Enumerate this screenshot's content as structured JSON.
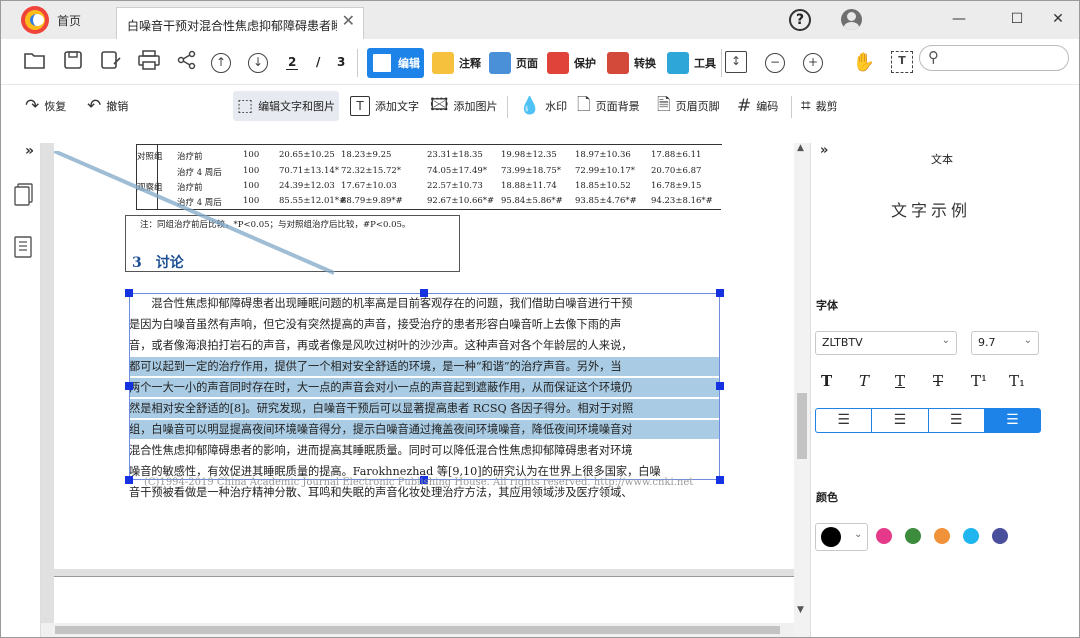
{
  "titlebar": {
    "home_tab": "首页",
    "doc_tab": "白噪音干预对混合性焦虑抑郁障碍患者睡眠质...",
    "close": "✕",
    "help": "?",
    "minimize": "—",
    "maximize": "☐",
    "close_window": "✕"
  },
  "toolbar": {
    "page_current": "2",
    "page_sep": "/",
    "page_total": "3",
    "modes": [
      {
        "label": "编辑",
        "color": "#1d83e8"
      },
      {
        "label": "注释",
        "color": "#f6c23e"
      },
      {
        "label": "页面",
        "color": "#4a90d9"
      },
      {
        "label": "保护",
        "color": "#e0433a"
      },
      {
        "label": "转换",
        "color": "#d44a3a"
      },
      {
        "label": "工具",
        "color": "#2ea7d8"
      }
    ],
    "search_placeholder": ""
  },
  "edit_tools": {
    "redo": "恢复",
    "undo": "撤销",
    "edit_text_image": "编辑文字和图片",
    "add_text": "添加文字",
    "add_image": "添加图片",
    "watermark": "水印",
    "page_background": "页面背景",
    "header_footer": "页眉页脚",
    "encode": "编码",
    "crop": "裁剪"
  },
  "sidebar": {
    "collapse": "»"
  },
  "table": {
    "rows": [
      [
        "对照组",
        "治疗前",
        "100",
        "20.65±10.25",
        "18.23±9.25",
        "23.31±18.35",
        "19.98±12.35",
        "18.97±10.36",
        "17.88±6.11"
      ],
      [
        "",
        "治疗 4 周后",
        "100",
        "70.71±13.14*",
        "72.32±15.72*",
        "74.05±17.49*",
        "73.99±18.75*",
        "72.99±10.17*",
        "20.70±6.87"
      ],
      [
        "观察组",
        "治疗前",
        "100",
        "24.39±12.03",
        "17.67±10.03",
        "22.57±10.73",
        "18.88±11.74",
        "18.85±10.52",
        "16.78±9.15"
      ],
      [
        "",
        "治疗 4 周后",
        "100",
        "85.55±12.01*#",
        "88.79±9.89*#",
        "92.67±10.66*#",
        "95.84±5.86*#",
        "93.85±4.76*#",
        "94.23±8.16*#"
      ]
    ]
  },
  "note_text": "注：同组治疗前后比较，*P<0.05；与对照组治疗后比较，#P<0.05。",
  "heading": "3　讨论",
  "paragraph_lines": [
    "　　混合性焦虑抑郁障碍患者出现睡眠问题的机率高是目前客观存在的问题，我们借助白噪音进行干预",
    "是因为白噪音虽然有声响，但它没有突然提高的声音，接受治疗的患者形容白噪音听上去像下雨的声",
    "音，或者像海浪拍打岩石的声音，再或者像是风吹过树叶的沙沙声。这种声音对各个年龄层的人来说，",
    "都可以起到一定的治疗作用，提供了一个相对安全舒适的环境，是一种“和谐”的治疗声音。另外，当",
    "两个一大一小的声音同时存在时，大一点的声音会对小一点的声音起到遮蔽作用，从而保证这个环境仍",
    "然是相对安全舒适的[8]。研究发现，白噪音干预后可以显著提高患者 RCSQ 各因子得分。相对于对照",
    "组，白噪音可以明显提高夜间环境噪音得分，提示白噪音通过掩盖夜间环境噪音，降低夜间环境噪音对",
    "混合性焦虑抑郁障碍患者的影响，进而提高其睡眠质量。同时可以降低混合性焦虑抑郁障碍患者对环境",
    "噪音的敏感性，有效促进其睡眠质量的提高。Farokhnezhad 等[9,10]的研究认为在世界上很多国家，白噪",
    "音干预被看做是一种治疗精神分散、耳鸣和失眠的声音化妆处理治疗方法，其应用领域涉及医疗领域、"
  ],
  "watermark": "(C)1994-2019 China Academic Journal Electronic Publishing House. All rights reserved.    http://www.cnki.net",
  "panel": {
    "collapse": "»",
    "title": "文本",
    "preview": "文字示例",
    "font_label": "字体",
    "font_name": "ZLTBTV",
    "font_size": "9.7",
    "style_buttons": [
      "T",
      "T",
      "T",
      "T",
      "T¹",
      "T₁"
    ],
    "color_label": "颜色",
    "current_color": "#000000",
    "swatches": [
      "#e6398a",
      "#3d8b3d",
      "#f0923a",
      "#1fb6f0",
      "#4a4f9c"
    ]
  }
}
